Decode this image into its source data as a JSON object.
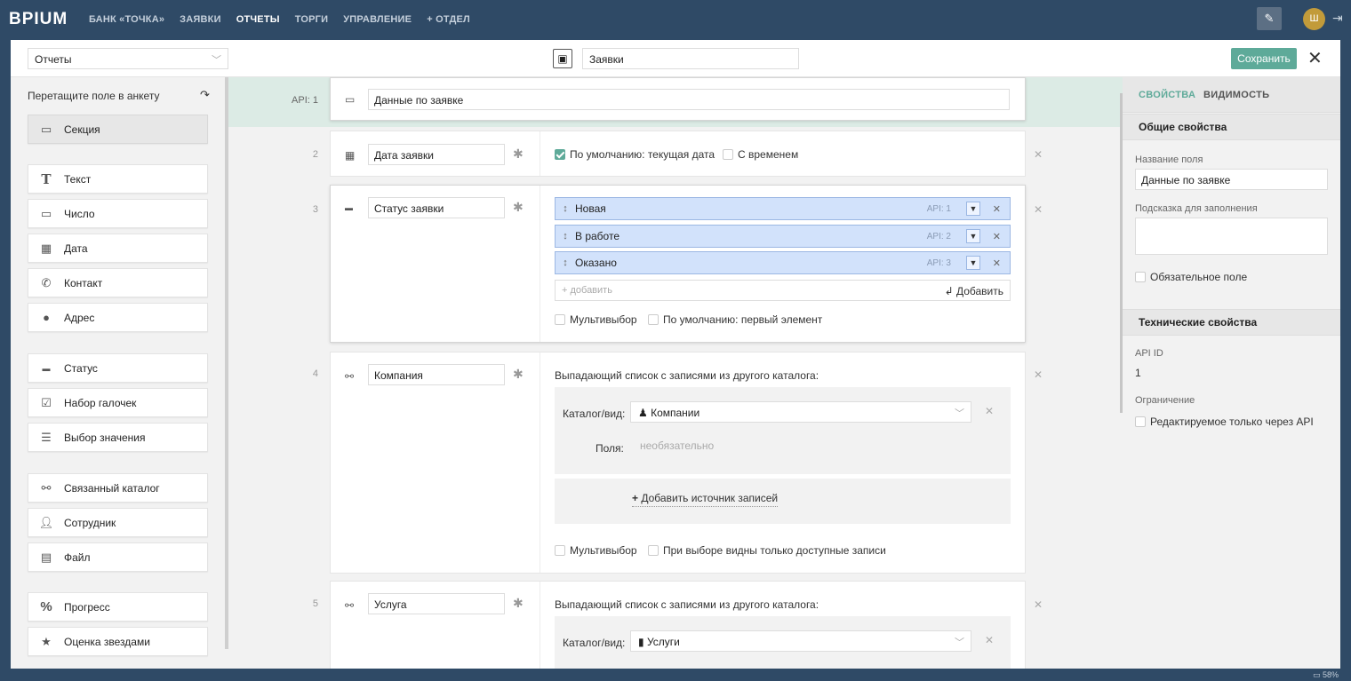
{
  "app": {
    "logo": "BPIUM"
  },
  "nav": [
    {
      "label": "БАНК «ТОЧКА»",
      "active": false
    },
    {
      "label": "ЗАЯВКИ",
      "active": false
    },
    {
      "label": "ОТЧЕТЫ",
      "active": true
    },
    {
      "label": "ТОРГИ",
      "active": false
    },
    {
      "label": "УПРАВЛЕНИЕ",
      "active": false
    },
    {
      "label": "+ ОТДЕЛ",
      "active": false
    }
  ],
  "user": {
    "avatar_initial": "Ш"
  },
  "header": {
    "catalog_select": "Отчеты",
    "catalog_name": "Заявки",
    "save_label": "Сохранить"
  },
  "sidebar": {
    "title": "Перетащите поле в анкету",
    "items": [
      {
        "label": "Секция",
        "icon": "section-icon"
      },
      {
        "label": "Текст",
        "icon": "text-icon"
      },
      {
        "label": "Число",
        "icon": "number-icon"
      },
      {
        "label": "Дата",
        "icon": "calendar-icon"
      },
      {
        "label": "Контакт",
        "icon": "phone-icon"
      },
      {
        "label": "Адрес",
        "icon": "map-pin-icon"
      },
      {
        "label": "Статус",
        "icon": "status-icon"
      },
      {
        "label": "Набор галочек",
        "icon": "checkbox-icon"
      },
      {
        "label": "Выбор значения",
        "icon": "list-icon"
      },
      {
        "label": "Связанный каталог",
        "icon": "link-icon"
      },
      {
        "label": "Сотрудник",
        "icon": "user-icon"
      },
      {
        "label": "Файл",
        "icon": "file-icon"
      },
      {
        "label": "Прогресс",
        "icon": "percent-icon"
      },
      {
        "label": "Оценка звездами",
        "icon": "star-icon"
      }
    ]
  },
  "form": {
    "section": {
      "api": "API: 1",
      "name": "Данные по заявке"
    },
    "fields": [
      {
        "num": "2",
        "name": "Дата заявки",
        "default_current": "По умолчанию: текущая дата",
        "with_time": "С временем"
      },
      {
        "num": "3",
        "name": "Статус заявки",
        "options": [
          {
            "label": "Новая",
            "api": "API: 1"
          },
          {
            "label": "В работе",
            "api": "API: 2"
          },
          {
            "label": "Оказано",
            "api": "API: 3"
          }
        ],
        "add_placeholder": "+ добавить",
        "add_button": "Добавить",
        "multi": "Мультивыбор",
        "default_first": "По умолчанию: первый элемент"
      },
      {
        "num": "4",
        "name": "Компания",
        "desc": "Выпадающий список с записями из другого каталога:",
        "catalog_label": "Каталог/вид:",
        "catalog_value": "Компании",
        "fields_label": "Поля:",
        "fields_placeholder": "необязательно",
        "add_source": "Добавить источник записей",
        "multi": "Мультивыбор",
        "only_available": "При выборе видны только доступные записи"
      },
      {
        "num": "5",
        "name": "Услуга",
        "desc": "Выпадающий список с записями из другого каталога:",
        "catalog_label": "Каталог/вид:",
        "catalog_value": "Услуги"
      }
    ]
  },
  "rpanel": {
    "tabs": [
      "СВОЙСТВА",
      "ВИДИМОСТЬ"
    ],
    "general": "Общие свойства",
    "field_name_label": "Название поля",
    "field_name_value": "Данные по заявке",
    "hint_label": "Подсказка для заполнения",
    "required": "Обязательное поле",
    "tech": "Технические свойства",
    "api_id_label": "API ID",
    "api_id_value": "1",
    "restriction_label": "Ограничение",
    "api_only": "Редактируемое только через API"
  },
  "status": {
    "battery": "58%"
  },
  "colors": {
    "topbar": "#2f4a66",
    "accent": "#5eaa99",
    "option_bg": "#d2e2fb"
  }
}
